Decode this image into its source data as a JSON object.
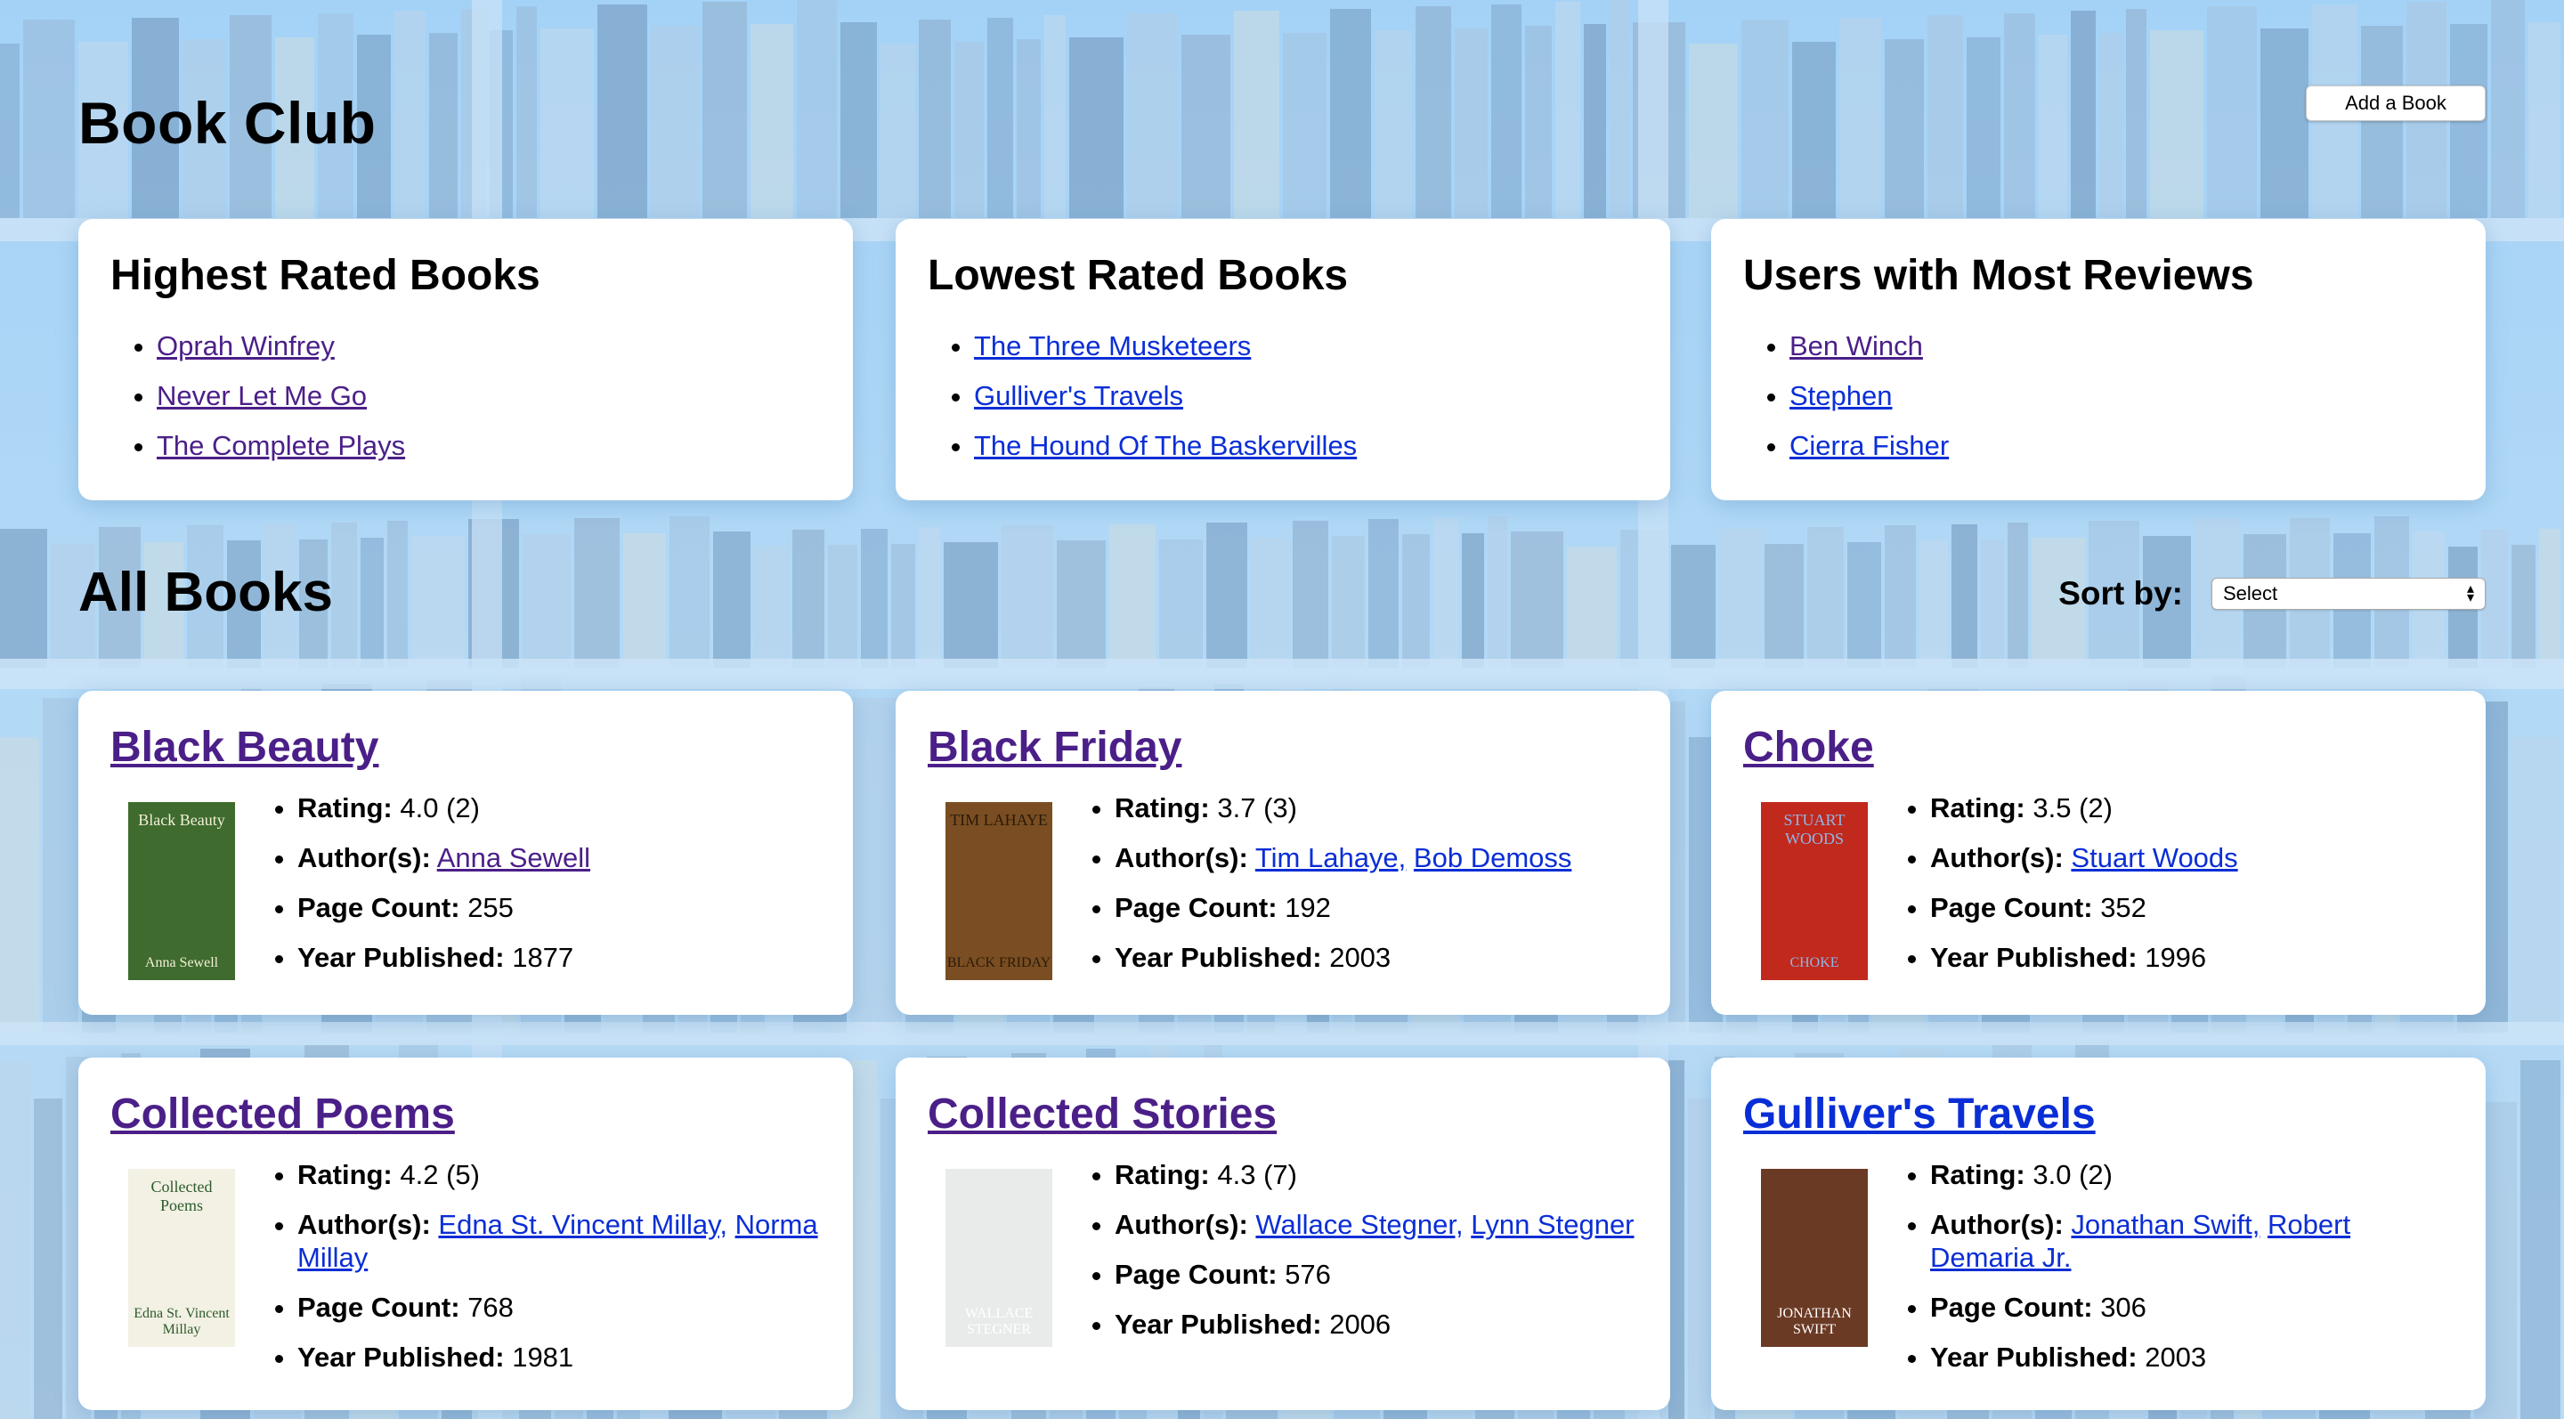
{
  "header": {
    "title": "Book Club",
    "add_button": "Add a Book"
  },
  "stats": [
    {
      "title": "Highest Rated Books",
      "items": [
        {
          "label": "Oprah Winfrey",
          "visited": true
        },
        {
          "label": "Never Let Me Go",
          "visited": true
        },
        {
          "label": "The Complete Plays",
          "visited": true
        }
      ]
    },
    {
      "title": "Lowest Rated Books",
      "items": [
        {
          "label": "The Three Musketeers",
          "visited": false
        },
        {
          "label": "Gulliver's Travels",
          "visited": false
        },
        {
          "label": "The Hound Of The Baskervilles",
          "visited": false
        }
      ]
    },
    {
      "title": "Users with Most Reviews",
      "items": [
        {
          "label": "Ben Winch",
          "visited": true
        },
        {
          "label": "Stephen",
          "visited": false
        },
        {
          "label": "Cierra Fisher",
          "visited": false
        }
      ]
    }
  ],
  "all_books": {
    "title": "All Books",
    "sort_label": "Sort by:",
    "sort_value": "Select"
  },
  "labels": {
    "rating": "Rating:",
    "authors": "Author(s):",
    "pages": "Page Count:",
    "year": "Year Published:"
  },
  "books": [
    {
      "title": "Black Beauty",
      "title_visited": true,
      "rating": "4.0 (2)",
      "authors": [
        {
          "name": "Anna Sewell",
          "visited": true
        }
      ],
      "pages": "255",
      "year": "1877",
      "cover": {
        "bg": "#3f6b2e",
        "top": "Black Beauty",
        "bottom": "Anna Sewell",
        "fg": "#f3f0d8"
      }
    },
    {
      "title": "Black Friday",
      "title_visited": true,
      "rating": "3.7 (3)",
      "authors": [
        {
          "name": "Tim Lahaye,",
          "visited": false
        },
        {
          "name": "Bob Demoss",
          "visited": false
        }
      ],
      "pages": "192",
      "year": "2003",
      "cover": {
        "bg": "#7a4e22",
        "top": "TIM LAHAYE",
        "bottom": "BLACK FRIDAY",
        "fg": "#2a1a0a"
      }
    },
    {
      "title": "Choke",
      "title_visited": true,
      "rating": "3.5 (2)",
      "authors": [
        {
          "name": "Stuart Woods",
          "visited": false
        }
      ],
      "pages": "352",
      "year": "1996",
      "cover": {
        "bg": "#c0291c",
        "top": "STUART WOODS",
        "bottom": "CHOKE",
        "fg": "#8fb6e8"
      }
    },
    {
      "title": "Collected Poems",
      "title_visited": true,
      "rating": "4.2 (5)",
      "authors": [
        {
          "name": "Edna St. Vincent Millay,",
          "visited": false
        },
        {
          "name": "Norma Millay",
          "visited": false
        }
      ],
      "pages": "768",
      "year": "1981",
      "cover": {
        "bg": "#f2f1e4",
        "top": "Collected Poems",
        "bottom": "Edna St. Vincent Millay",
        "fg": "#2d5a2a"
      }
    },
    {
      "title": "Collected Stories",
      "title_visited": true,
      "rating": "4.3 (7)",
      "authors": [
        {
          "name": "Wallace Stegner,",
          "visited": false
        },
        {
          "name": "Lynn Stegner",
          "visited": false
        }
      ],
      "pages": "576",
      "year": "2006",
      "cover": {
        "bg": "#e9ebea",
        "top": "",
        "bottom": "WALLACE STEGNER",
        "fg": "#ffffff"
      }
    },
    {
      "title": "Gulliver's Travels",
      "title_visited": false,
      "rating": "3.0 (2)",
      "authors": [
        {
          "name": "Jonathan Swift,",
          "visited": false
        },
        {
          "name": "Robert Demaria Jr.",
          "visited": false
        }
      ],
      "pages": "306",
      "year": "2003",
      "cover": {
        "bg": "#6b3a24",
        "top": "",
        "bottom": "JONATHAN SWIFT",
        "fg": "#ffffff"
      }
    }
  ]
}
